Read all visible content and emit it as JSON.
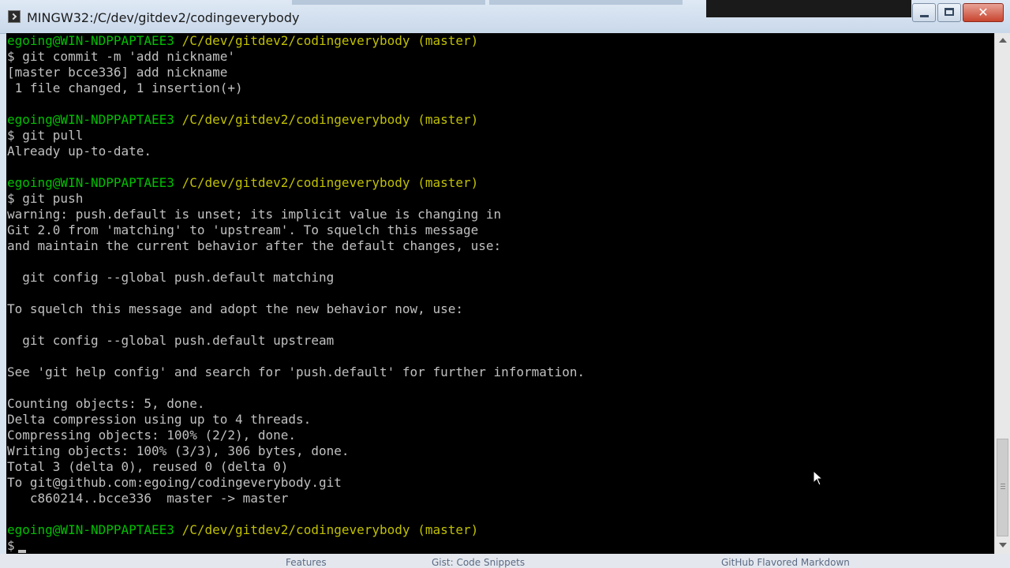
{
  "window": {
    "title": "MINGW32:/C/dev/gitdev2/codingeverybody",
    "close_glyph": "✕"
  },
  "terminal": {
    "lines": [
      {
        "type": "prompt",
        "user": "egoing@WIN-NDPPAPTAEE3",
        "path": "/C/dev/gitdev2/codingeverybody",
        "branch": "(master)"
      },
      {
        "type": "text",
        "text": "$ git commit -m 'add nickname'"
      },
      {
        "type": "text",
        "text": "[master bcce336] add nickname"
      },
      {
        "type": "text",
        "text": " 1 file changed, 1 insertion(+)"
      },
      {
        "type": "text",
        "text": ""
      },
      {
        "type": "prompt",
        "user": "egoing@WIN-NDPPAPTAEE3",
        "path": "/C/dev/gitdev2/codingeverybody",
        "branch": "(master)"
      },
      {
        "type": "text",
        "text": "$ git pull"
      },
      {
        "type": "text",
        "text": "Already up-to-date."
      },
      {
        "type": "text",
        "text": ""
      },
      {
        "type": "prompt",
        "user": "egoing@WIN-NDPPAPTAEE3",
        "path": "/C/dev/gitdev2/codingeverybody",
        "branch": "(master)"
      },
      {
        "type": "text",
        "text": "$ git push"
      },
      {
        "type": "text",
        "text": "warning: push.default is unset; its implicit value is changing in"
      },
      {
        "type": "text",
        "text": "Git 2.0 from 'matching' to 'upstream'. To squelch this message"
      },
      {
        "type": "text",
        "text": "and maintain the current behavior after the default changes, use:"
      },
      {
        "type": "text",
        "text": ""
      },
      {
        "type": "text",
        "text": "  git config --global push.default matching"
      },
      {
        "type": "text",
        "text": ""
      },
      {
        "type": "text",
        "text": "To squelch this message and adopt the new behavior now, use:"
      },
      {
        "type": "text",
        "text": ""
      },
      {
        "type": "text",
        "text": "  git config --global push.default upstream"
      },
      {
        "type": "text",
        "text": ""
      },
      {
        "type": "text",
        "text": "See 'git help config' and search for 'push.default' for further information."
      },
      {
        "type": "text",
        "text": ""
      },
      {
        "type": "text",
        "text": "Counting objects: 5, done."
      },
      {
        "type": "text",
        "text": "Delta compression using up to 4 threads."
      },
      {
        "type": "text",
        "text": "Compressing objects: 100% (2/2), done."
      },
      {
        "type": "text",
        "text": "Writing objects: 100% (3/3), 306 bytes, done."
      },
      {
        "type": "text",
        "text": "Total 3 (delta 0), reused 0 (delta 0)"
      },
      {
        "type": "text",
        "text": "To git@github.com:egoing/codingeverybody.git"
      },
      {
        "type": "text",
        "text": "   c860214..bcce336  master -> master"
      },
      {
        "type": "text",
        "text": ""
      },
      {
        "type": "prompt",
        "user": "egoing@WIN-NDPPAPTAEE3",
        "path": "/C/dev/gitdev2/codingeverybody",
        "branch": "(master)"
      },
      {
        "type": "input",
        "text": "$"
      }
    ]
  },
  "background_window": {
    "items": [
      "Features",
      "Gist: Code Snippets",
      "GitHub Flavored Markdown"
    ]
  },
  "colors": {
    "prompt_user": "#00c000",
    "prompt_path": "#c0c000",
    "terminal_text": "#c0c0c0",
    "terminal_bg": "#000000"
  }
}
